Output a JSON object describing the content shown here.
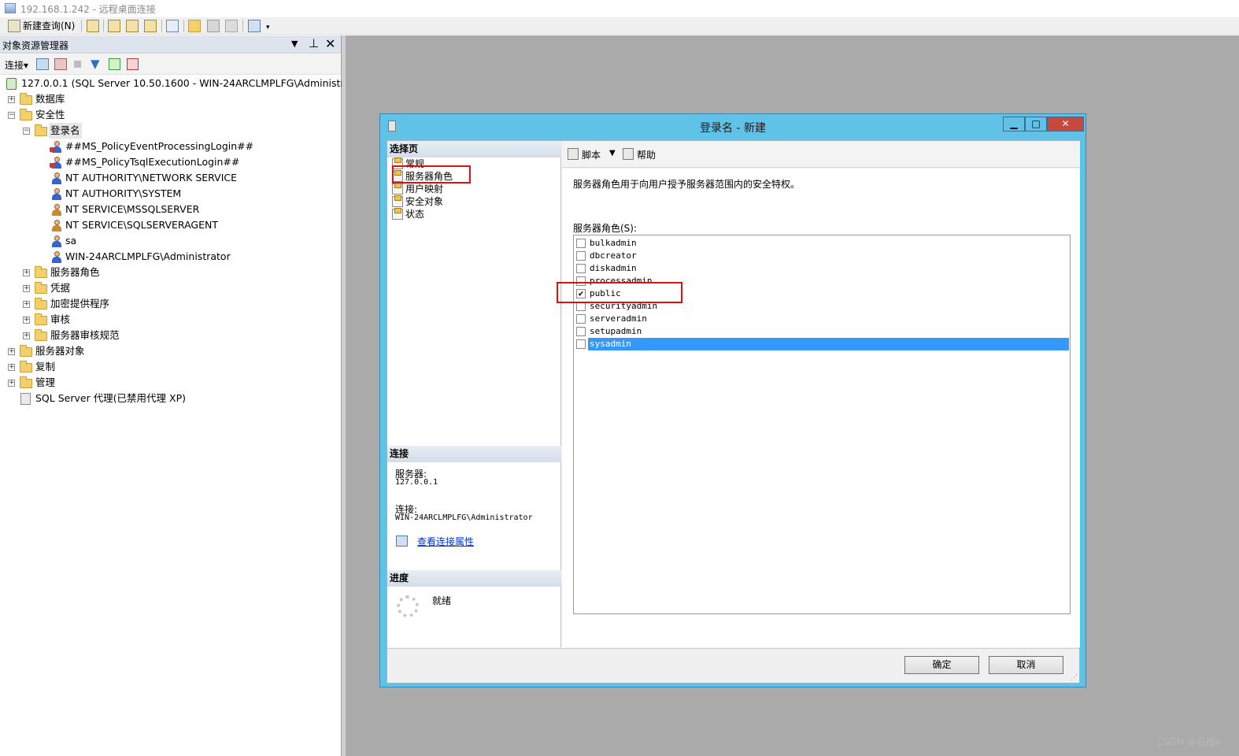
{
  "window": {
    "title": "192.168.1.242 - 远程桌面连接"
  },
  "toolbar": {
    "new_query_label": "新建查询(N)"
  },
  "object_explorer": {
    "title": "对象资源管理器",
    "connect_label": "连接",
    "server_node": "127.0.0.1 (SQL Server 10.50.1600 - WIN-24ARCLMPLFG\\Administrator)",
    "nodes": {
      "databases": "数据库",
      "security": "安全性",
      "logins": "登录名",
      "login_items": [
        "##MS_PolicyEventProcessingLogin##",
        "##MS_PolicyTsqlExecutionLogin##",
        "NT AUTHORITY\\NETWORK SERVICE",
        "NT AUTHORITY\\SYSTEM",
        "NT SERVICE\\MSSQLSERVER",
        "NT SERVICE\\SQLSERVERAGENT",
        "sa",
        "WIN-24ARCLMPLFG\\Administrator"
      ],
      "server_roles": "服务器角色",
      "credentials": "凭据",
      "crypto_providers": "加密提供程序",
      "audits": "审核",
      "server_audit_specs": "服务器审核规范",
      "server_objects": "服务器对象",
      "replication": "复制",
      "management": "管理",
      "agent": "SQL Server 代理(已禁用代理 XP)"
    }
  },
  "dialog": {
    "title": "登录名 - 新建",
    "select_page_header": "选择页",
    "pages": [
      "常规",
      "服务器角色",
      "用户映射",
      "安全对象",
      "状态"
    ],
    "script_label": "脚本",
    "help_label": "帮助",
    "description": "服务器角色用于向用户授予服务器范围内的安全特权。",
    "roles_label": "服务器角色(S):",
    "roles": [
      {
        "name": "bulkadmin",
        "checked": false
      },
      {
        "name": "dbcreator",
        "checked": false
      },
      {
        "name": "diskadmin",
        "checked": false
      },
      {
        "name": "processadmin",
        "checked": false
      },
      {
        "name": "public",
        "checked": true
      },
      {
        "name": "securityadmin",
        "checked": false
      },
      {
        "name": "serveradmin",
        "checked": false
      },
      {
        "name": "setupadmin",
        "checked": false
      },
      {
        "name": "sysadmin",
        "checked": false
      }
    ],
    "selected_role": "sysadmin",
    "connection_header": "连接",
    "server_label": "服务器:",
    "server_value": "127.0.0.1",
    "connection_label": "连接:",
    "connection_value": "WIN-24ARCLMPLFG\\Administrator",
    "view_props_link": "查看连接属性",
    "progress_header": "进度",
    "progress_status": "就绪",
    "ok_label": "确定",
    "cancel_label": "取消",
    "check_glyph": "✔",
    "min_glyph": "▁",
    "max_glyph": "□",
    "close_glyph": "✕"
  },
  "watermark": "CSDN @石榴x",
  "colors": {
    "dialog_frame": "#61c2e8",
    "selection": "#3399ff",
    "highlight_box": "#e01010",
    "close_button": "#c9483d"
  }
}
